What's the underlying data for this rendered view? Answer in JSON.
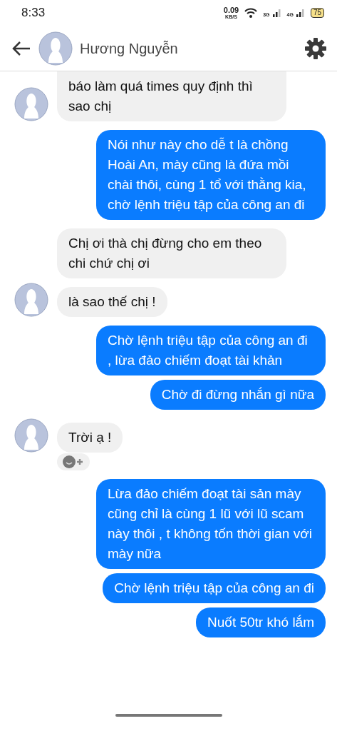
{
  "status_bar": {
    "time": "8:33",
    "speed_value": "0.09",
    "speed_unit": "KB/S",
    "networks": [
      "3G",
      "4G"
    ],
    "battery": "75"
  },
  "header": {
    "name": "Hương Nguyễn"
  },
  "messages": [
    {
      "kind": "received",
      "avatar": true,
      "cut_top": true,
      "text": "báo làm quá times quy định thì sao chị"
    },
    {
      "kind": "sent",
      "text": "Nói như này cho dễ t là chồng Hoài An, mày cũng là đứa mồi chài thôi, cùng 1 tổ với thằng kia, chờ lệnh triệu tập của công an đi"
    },
    {
      "kind": "received",
      "avatar": false,
      "text": "Chị ơi thà chị đừng cho em theo chi chứ chị ơi"
    },
    {
      "kind": "received",
      "avatar": true,
      "text": "là sao thế chị !"
    },
    {
      "kind": "sent",
      "text": "Chờ lệnh triệu tập của công an đi , lừa đảo chiếm đoạt tài khản"
    },
    {
      "kind": "sent",
      "text": "Chờ đi đừng nhắn gì nữa"
    },
    {
      "kind": "received",
      "avatar": true,
      "reaction": true,
      "text": "Trời ạ !"
    },
    {
      "kind": "sent",
      "text": "Lừa đảo chiếm đoạt tài sản mày cũng chỉ là cùng 1 lũ với lũ scam này thôi , t không tốn thời gian với mày nữa"
    },
    {
      "kind": "sent",
      "text": "Chờ lệnh triệu tập của công an đi"
    },
    {
      "kind": "sent",
      "text": "Nuốt 50tr khó lắm"
    }
  ]
}
